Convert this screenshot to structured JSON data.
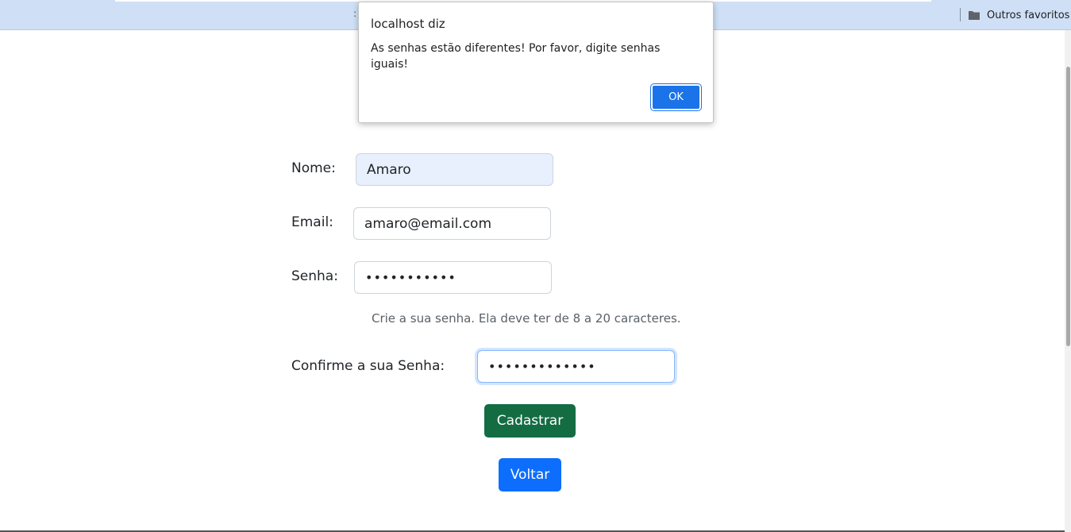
{
  "browser": {
    "bookmarks_bar": {
      "grip": ":",
      "other_bookmarks_label": "Outros favoritos"
    }
  },
  "dialog": {
    "title": "localhost diz",
    "message": "As senhas estão diferentes! Por favor, digite senhas iguais!",
    "ok_label": "OK"
  },
  "form": {
    "name_label": "Nome:",
    "name_value": "Amaro",
    "email_label": "Email:",
    "email_value": "amaro@email.com",
    "password_label": "Senha:",
    "password_value": "•••••••••••",
    "password_hint": "Crie a sua senha. Ela deve ter de 8 a 20 caracteres.",
    "confirm_label": "Confirme a sua Senha:",
    "confirm_value": "•••••••••••••",
    "submit_label": "Cadastrar",
    "back_label": "Voltar"
  },
  "colors": {
    "submit": "#146c43",
    "back": "#0d6efd",
    "dialog_ok": "#1a73e8",
    "bookmarks_bar": "#cfe0f6"
  }
}
